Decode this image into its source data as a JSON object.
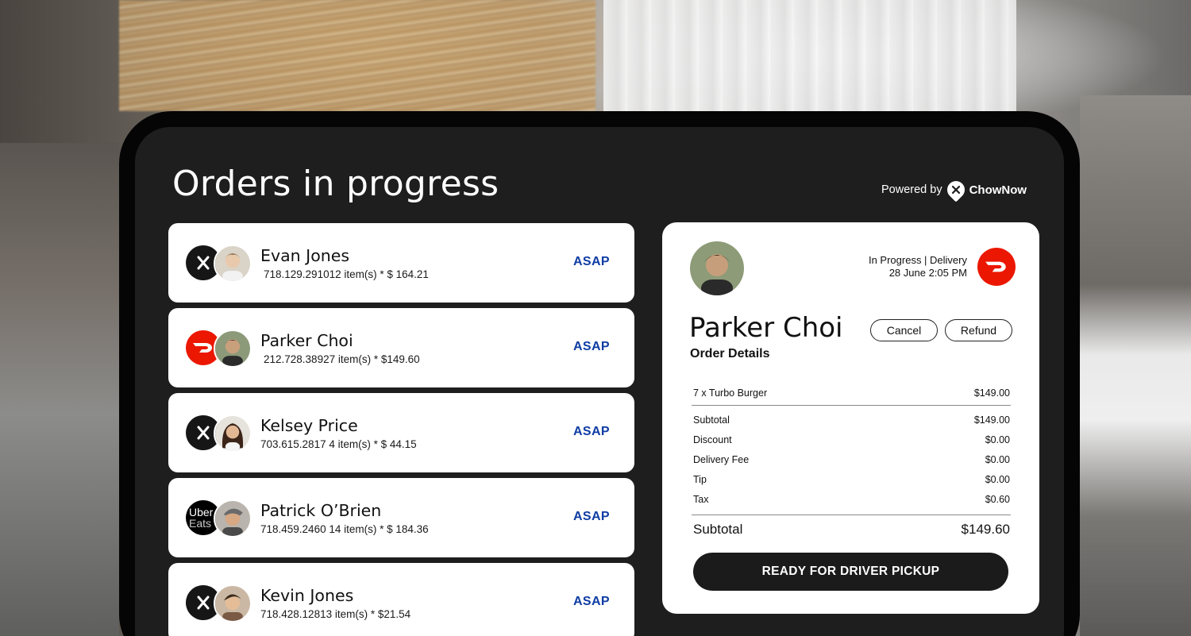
{
  "header": {
    "title": "Orders in progress",
    "powered_by": "Powered by",
    "brand": "ChowNow"
  },
  "orders": [
    {
      "name": "Evan Jones",
      "meta": "718.129.291012 item(s) * $ 164.21",
      "eta": "ASAP",
      "platform_icon": "chownow-pin-icon"
    },
    {
      "name": "Parker Choi",
      "meta": "212.728.38927 item(s) * $149.60",
      "eta": "ASAP",
      "platform_icon": "doordash-icon"
    },
    {
      "name": "Kelsey Price",
      "meta": "703.615.2817 4 item(s) * $ 44.15",
      "eta": "ASAP",
      "platform_icon": "chownow-pin-icon"
    },
    {
      "name": "Patrick O’Brien",
      "meta": "718.459.2460 14 item(s) * $ 184.36",
      "eta": "ASAP",
      "platform_icon": "ubereats-icon",
      "platform_text": [
        "Uber",
        "Eats"
      ]
    },
    {
      "name": "Kevin Jones",
      "meta": "718.428.12813 item(s) * $21.54",
      "eta": "ASAP",
      "platform_icon": "chownow-pin-icon"
    }
  ],
  "detail": {
    "status": "In Progress | Delivery",
    "datetime": "28 June 2:05 PM",
    "name": "Parker Choi",
    "section_label": "Order Details",
    "cancel_label": "Cancel",
    "refund_label": "Refund",
    "items": [
      {
        "label": "7 x Turbo Burger",
        "amount": "$149.00"
      }
    ],
    "breakdown": [
      {
        "label": "Subtotal",
        "amount": "$149.00"
      },
      {
        "label": "Discount",
        "amount": "$0.00"
      },
      {
        "label": "Delivery Fee",
        "amount": "$0.00"
      },
      {
        "label": "Tip",
        "amount": "$0.00"
      },
      {
        "label": "Tax",
        "amount": "$0.60"
      }
    ],
    "total": {
      "label": "Subtotal",
      "amount": "$149.60"
    },
    "action_label": "READY FOR DRIVER PICKUP"
  },
  "colors": {
    "accent_link": "#0e3ca3",
    "doordash_red": "#eb1700",
    "screen_bg": "#1e1e1e"
  }
}
